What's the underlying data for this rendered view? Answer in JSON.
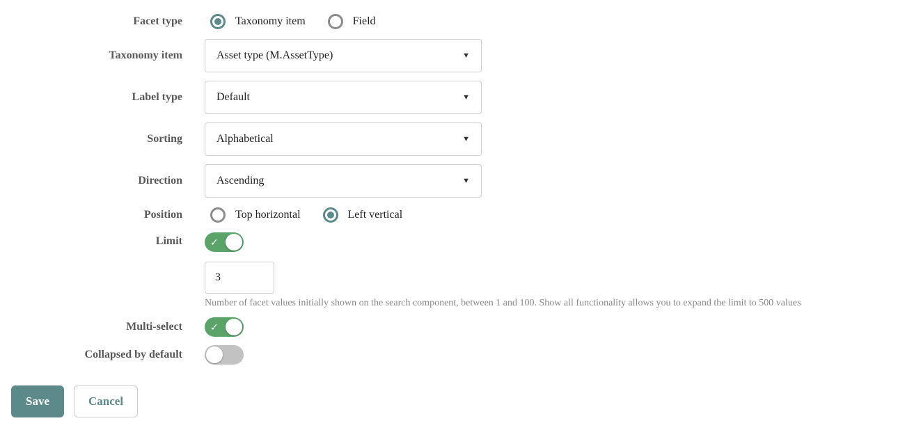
{
  "labels": {
    "facet_type": "Facet type",
    "taxonomy_item": "Taxonomy item",
    "label_type": "Label type",
    "sorting": "Sorting",
    "direction": "Direction",
    "position": "Position",
    "limit": "Limit",
    "multi_select": "Multi-select",
    "collapsed": "Collapsed by default"
  },
  "facet_type": {
    "options": {
      "taxonomy": "Taxonomy item",
      "field": "Field"
    },
    "selected": "taxonomy"
  },
  "taxonomy_item": {
    "value": "Asset type (M.AssetType)"
  },
  "label_type": {
    "value": "Default"
  },
  "sorting": {
    "value": "Alphabetical"
  },
  "direction": {
    "value": "Ascending"
  },
  "position": {
    "options": {
      "top": "Top horizontal",
      "left": "Left vertical"
    },
    "selected": "left"
  },
  "limit": {
    "enabled": true,
    "value": "3",
    "help": "Number of facet values initially shown on the search component, between 1 and 100. Show all functionality allows you to expand the limit to 500 values"
  },
  "multi_select": {
    "enabled": true
  },
  "collapsed": {
    "enabled": false
  },
  "actions": {
    "save": "Save",
    "cancel": "Cancel"
  }
}
